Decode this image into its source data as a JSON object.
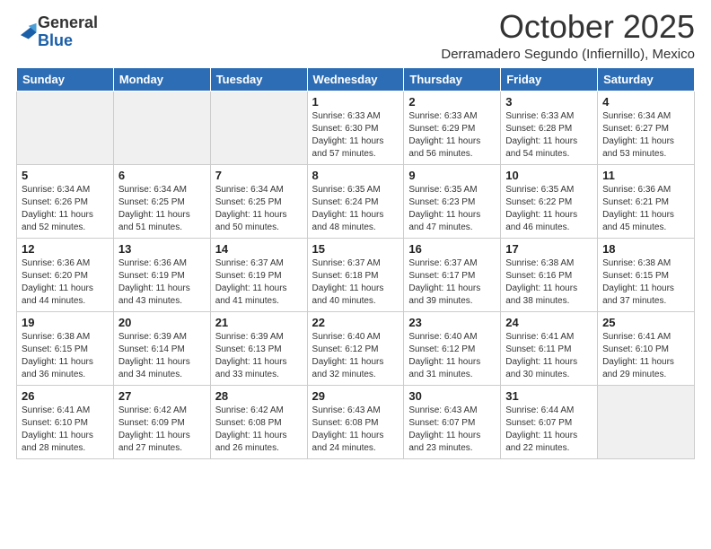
{
  "logo": {
    "general": "General",
    "blue": "Blue"
  },
  "header": {
    "month": "October 2025",
    "location": "Derramadero Segundo (Infiernillo), Mexico"
  },
  "weekdays": [
    "Sunday",
    "Monday",
    "Tuesday",
    "Wednesday",
    "Thursday",
    "Friday",
    "Saturday"
  ],
  "weeks": [
    [
      {
        "day": "",
        "info": ""
      },
      {
        "day": "",
        "info": ""
      },
      {
        "day": "",
        "info": ""
      },
      {
        "day": "1",
        "info": "Sunrise: 6:33 AM\nSunset: 6:30 PM\nDaylight: 11 hours\nand 57 minutes."
      },
      {
        "day": "2",
        "info": "Sunrise: 6:33 AM\nSunset: 6:29 PM\nDaylight: 11 hours\nand 56 minutes."
      },
      {
        "day": "3",
        "info": "Sunrise: 6:33 AM\nSunset: 6:28 PM\nDaylight: 11 hours\nand 54 minutes."
      },
      {
        "day": "4",
        "info": "Sunrise: 6:34 AM\nSunset: 6:27 PM\nDaylight: 11 hours\nand 53 minutes."
      }
    ],
    [
      {
        "day": "5",
        "info": "Sunrise: 6:34 AM\nSunset: 6:26 PM\nDaylight: 11 hours\nand 52 minutes."
      },
      {
        "day": "6",
        "info": "Sunrise: 6:34 AM\nSunset: 6:25 PM\nDaylight: 11 hours\nand 51 minutes."
      },
      {
        "day": "7",
        "info": "Sunrise: 6:34 AM\nSunset: 6:25 PM\nDaylight: 11 hours\nand 50 minutes."
      },
      {
        "day": "8",
        "info": "Sunrise: 6:35 AM\nSunset: 6:24 PM\nDaylight: 11 hours\nand 48 minutes."
      },
      {
        "day": "9",
        "info": "Sunrise: 6:35 AM\nSunset: 6:23 PM\nDaylight: 11 hours\nand 47 minutes."
      },
      {
        "day": "10",
        "info": "Sunrise: 6:35 AM\nSunset: 6:22 PM\nDaylight: 11 hours\nand 46 minutes."
      },
      {
        "day": "11",
        "info": "Sunrise: 6:36 AM\nSunset: 6:21 PM\nDaylight: 11 hours\nand 45 minutes."
      }
    ],
    [
      {
        "day": "12",
        "info": "Sunrise: 6:36 AM\nSunset: 6:20 PM\nDaylight: 11 hours\nand 44 minutes."
      },
      {
        "day": "13",
        "info": "Sunrise: 6:36 AM\nSunset: 6:19 PM\nDaylight: 11 hours\nand 43 minutes."
      },
      {
        "day": "14",
        "info": "Sunrise: 6:37 AM\nSunset: 6:19 PM\nDaylight: 11 hours\nand 41 minutes."
      },
      {
        "day": "15",
        "info": "Sunrise: 6:37 AM\nSunset: 6:18 PM\nDaylight: 11 hours\nand 40 minutes."
      },
      {
        "day": "16",
        "info": "Sunrise: 6:37 AM\nSunset: 6:17 PM\nDaylight: 11 hours\nand 39 minutes."
      },
      {
        "day": "17",
        "info": "Sunrise: 6:38 AM\nSunset: 6:16 PM\nDaylight: 11 hours\nand 38 minutes."
      },
      {
        "day": "18",
        "info": "Sunrise: 6:38 AM\nSunset: 6:15 PM\nDaylight: 11 hours\nand 37 minutes."
      }
    ],
    [
      {
        "day": "19",
        "info": "Sunrise: 6:38 AM\nSunset: 6:15 PM\nDaylight: 11 hours\nand 36 minutes."
      },
      {
        "day": "20",
        "info": "Sunrise: 6:39 AM\nSunset: 6:14 PM\nDaylight: 11 hours\nand 34 minutes."
      },
      {
        "day": "21",
        "info": "Sunrise: 6:39 AM\nSunset: 6:13 PM\nDaylight: 11 hours\nand 33 minutes."
      },
      {
        "day": "22",
        "info": "Sunrise: 6:40 AM\nSunset: 6:12 PM\nDaylight: 11 hours\nand 32 minutes."
      },
      {
        "day": "23",
        "info": "Sunrise: 6:40 AM\nSunset: 6:12 PM\nDaylight: 11 hours\nand 31 minutes."
      },
      {
        "day": "24",
        "info": "Sunrise: 6:41 AM\nSunset: 6:11 PM\nDaylight: 11 hours\nand 30 minutes."
      },
      {
        "day": "25",
        "info": "Sunrise: 6:41 AM\nSunset: 6:10 PM\nDaylight: 11 hours\nand 29 minutes."
      }
    ],
    [
      {
        "day": "26",
        "info": "Sunrise: 6:41 AM\nSunset: 6:10 PM\nDaylight: 11 hours\nand 28 minutes."
      },
      {
        "day": "27",
        "info": "Sunrise: 6:42 AM\nSunset: 6:09 PM\nDaylight: 11 hours\nand 27 minutes."
      },
      {
        "day": "28",
        "info": "Sunrise: 6:42 AM\nSunset: 6:08 PM\nDaylight: 11 hours\nand 26 minutes."
      },
      {
        "day": "29",
        "info": "Sunrise: 6:43 AM\nSunset: 6:08 PM\nDaylight: 11 hours\nand 24 minutes."
      },
      {
        "day": "30",
        "info": "Sunrise: 6:43 AM\nSunset: 6:07 PM\nDaylight: 11 hours\nand 23 minutes."
      },
      {
        "day": "31",
        "info": "Sunrise: 6:44 AM\nSunset: 6:07 PM\nDaylight: 11 hours\nand 22 minutes."
      },
      {
        "day": "",
        "info": ""
      }
    ]
  ]
}
